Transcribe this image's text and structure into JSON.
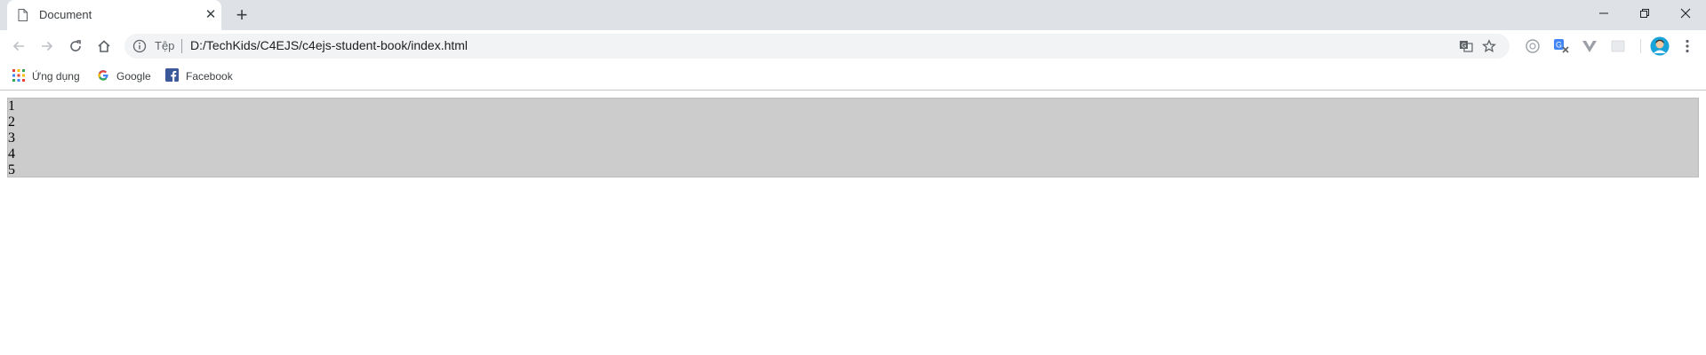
{
  "browser": {
    "tab": {
      "title": "Document",
      "favicon": "document-icon",
      "close": "✕"
    },
    "new_tab": "+",
    "window_controls": {
      "minimize": "minimize-icon",
      "restore": "restore-icon",
      "close": "close-icon"
    },
    "toolbar": {
      "scheme_label": "Tệp",
      "url": "D:/TechKids/C4EJS/c4ejs-student-book/index.html"
    },
    "bookmarks": [
      {
        "label": "Ứng dụng",
        "icon": "apps-grid-icon"
      },
      {
        "label": "Google",
        "icon": "google-icon"
      },
      {
        "label": "Facebook",
        "icon": "facebook-icon"
      }
    ]
  },
  "page": {
    "items": [
      "1",
      "2",
      "3",
      "4",
      "5"
    ],
    "list_background": "#cccccc"
  }
}
